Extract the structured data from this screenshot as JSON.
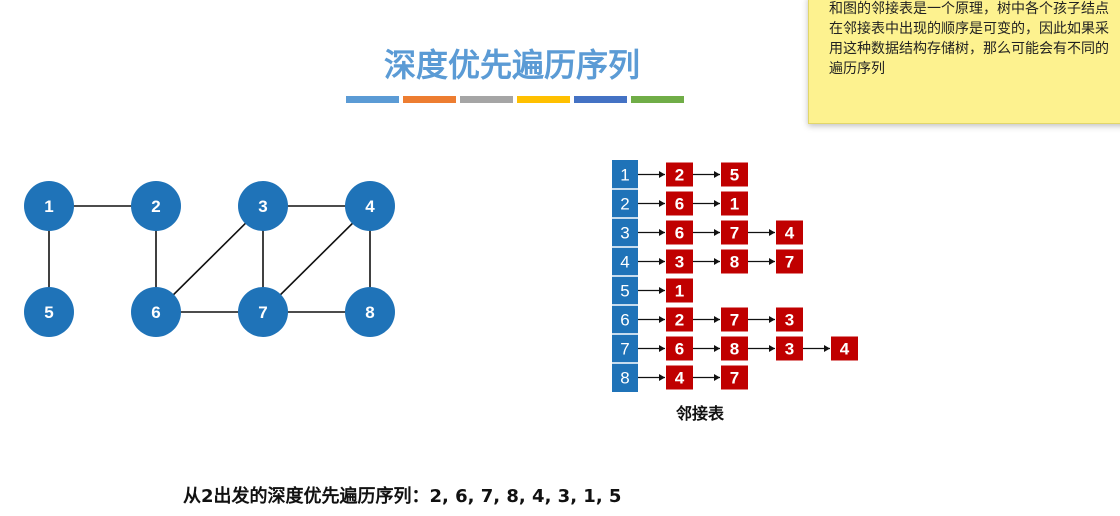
{
  "title": "深度优先遍历序列",
  "color_bar": [
    "#5b9bd5",
    "#ed7d31",
    "#a5a5a5",
    "#ffc000",
    "#4472c4",
    "#70ad47"
  ],
  "note": {
    "lines": [
      "和图的邻接表是一个原理，树中各个孩子结点",
      "在邻接表中出现的顺序是可变的，因此如果采",
      "用这种数据结构存储树，那么可能会有不同的",
      "遍历序列"
    ]
  },
  "graph": {
    "node_color": "#1f73b8",
    "nodes": [
      {
        "id": "1",
        "label": "1"
      },
      {
        "id": "2",
        "label": "2"
      },
      {
        "id": "3",
        "label": "3"
      },
      {
        "id": "4",
        "label": "4"
      },
      {
        "id": "5",
        "label": "5"
      },
      {
        "id": "6",
        "label": "6"
      },
      {
        "id": "7",
        "label": "7"
      },
      {
        "id": "8",
        "label": "8"
      }
    ],
    "edges": [
      [
        "1",
        "2"
      ],
      [
        "1",
        "5"
      ],
      [
        "2",
        "6"
      ],
      [
        "3",
        "4"
      ],
      [
        "3",
        "6"
      ],
      [
        "3",
        "7"
      ],
      [
        "4",
        "7"
      ],
      [
        "4",
        "8"
      ],
      [
        "6",
        "7"
      ],
      [
        "7",
        "8"
      ]
    ]
  },
  "adjacency": {
    "head_color": "#1f73b8",
    "node_color": "#c00000",
    "label": "邻接表",
    "rows": [
      {
        "head": "1",
        "list": [
          "2",
          "5"
        ]
      },
      {
        "head": "2",
        "list": [
          "6",
          "1"
        ]
      },
      {
        "head": "3",
        "list": [
          "6",
          "7",
          "4"
        ]
      },
      {
        "head": "4",
        "list": [
          "3",
          "8",
          "7"
        ]
      },
      {
        "head": "5",
        "list": [
          "1"
        ]
      },
      {
        "head": "6",
        "list": [
          "2",
          "7",
          "3"
        ]
      },
      {
        "head": "7",
        "list": [
          "6",
          "8",
          "3",
          "4"
        ]
      },
      {
        "head": "8",
        "list": [
          "4",
          "7"
        ]
      }
    ]
  },
  "caption": "从2出发的深度优先遍历序列：2, 6, 7, 8, 4, 3, 1, 5"
}
